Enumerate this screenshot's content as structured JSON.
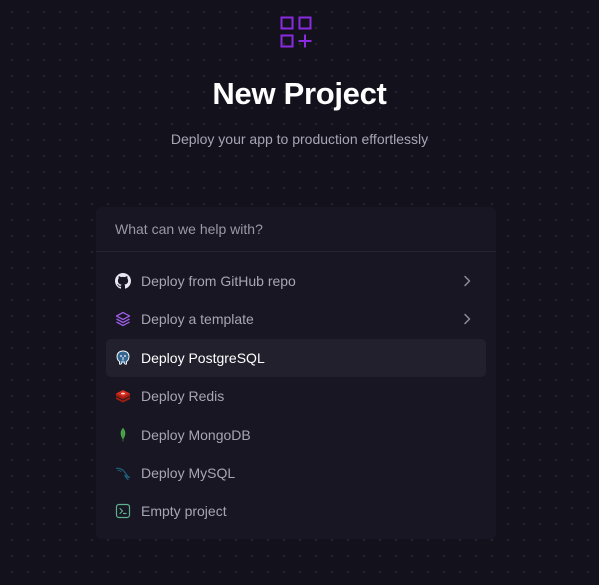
{
  "header": {
    "title": "New Project",
    "subtitle": "Deploy your app to production effortlessly",
    "logo_icon": "grid-plus-icon"
  },
  "search": {
    "placeholder": "What can we help with?",
    "value": ""
  },
  "menu": {
    "items": [
      {
        "label": "Deploy from GitHub repo",
        "icon": "github-icon",
        "has_submenu": true,
        "active": false
      },
      {
        "label": "Deploy a template",
        "icon": "layers-icon",
        "has_submenu": true,
        "active": false
      },
      {
        "label": "Deploy PostgreSQL",
        "icon": "postgresql-icon",
        "has_submenu": false,
        "active": true
      },
      {
        "label": "Deploy Redis",
        "icon": "redis-icon",
        "has_submenu": false,
        "active": false
      },
      {
        "label": "Deploy MongoDB",
        "icon": "mongodb-icon",
        "has_submenu": false,
        "active": false
      },
      {
        "label": "Deploy MySQL",
        "icon": "mysql-icon",
        "has_submenu": false,
        "active": false
      },
      {
        "label": "Empty project",
        "icon": "terminal-icon",
        "has_submenu": false,
        "active": false
      }
    ]
  },
  "colors": {
    "background": "#13111c",
    "panel": "#181622",
    "accent": "#8a2be2",
    "active_row": "#22202d"
  }
}
